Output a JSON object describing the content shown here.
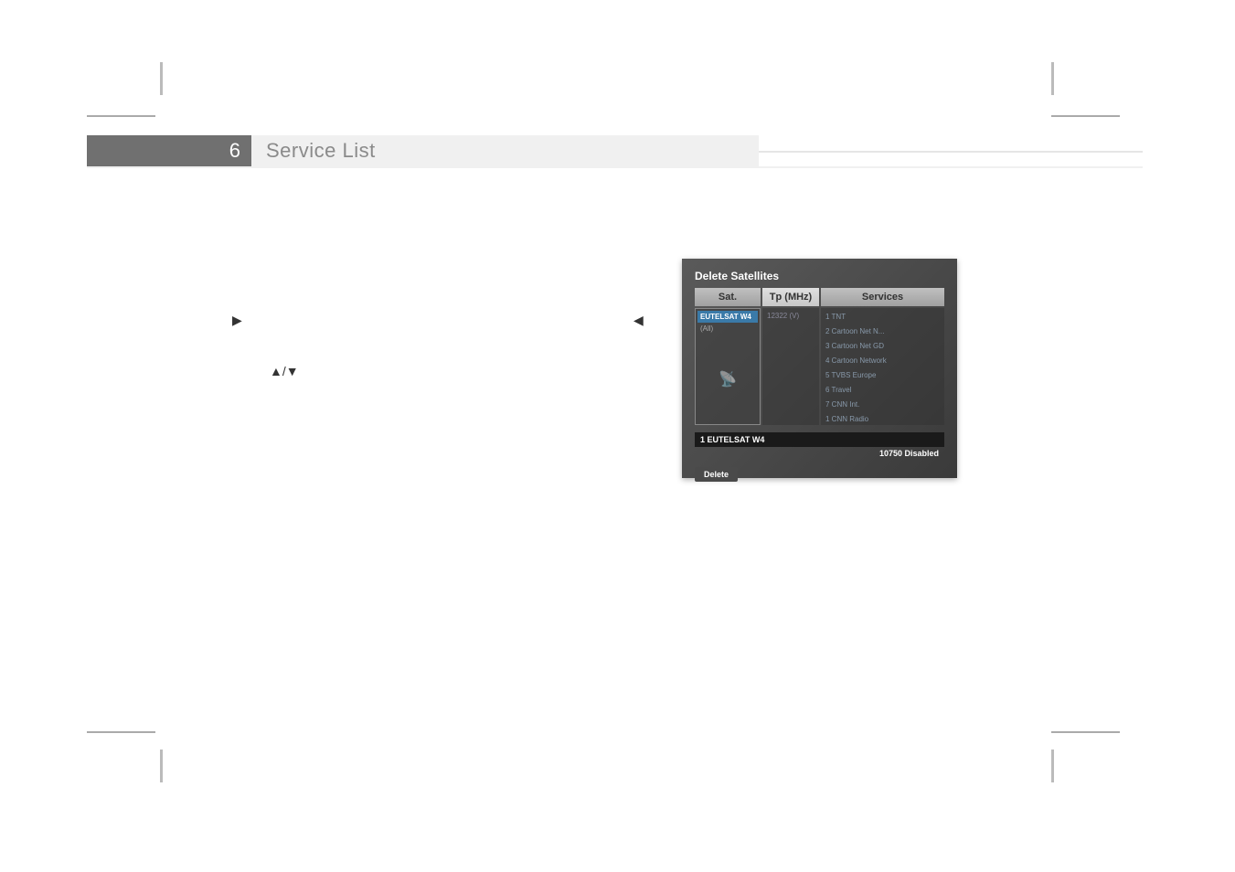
{
  "section": {
    "number": "6",
    "title": "Service List"
  },
  "arrows": {
    "right": "▶",
    "left": "◀",
    "updown": "▲/▼"
  },
  "dialog": {
    "title": "Delete Satellites",
    "headers": {
      "sat": "Sat.",
      "tp": "Tp (MHz)",
      "services": "Services"
    },
    "sat_selected": "EUTELSAT W4",
    "sat_all": "(All)",
    "tp_value": "12322 (V)",
    "services": [
      "1 TNT",
      "2 Cartoon Net N...",
      "3 Cartoon Net GD",
      "4 Cartoon Network",
      "5 TVBS Europe",
      "6 Travel",
      "7 CNN Int.",
      "1 CNN Radio"
    ],
    "status_left": "1 EUTELSAT W4",
    "status_right": "10750  Disabled",
    "delete_label": "Delete"
  }
}
